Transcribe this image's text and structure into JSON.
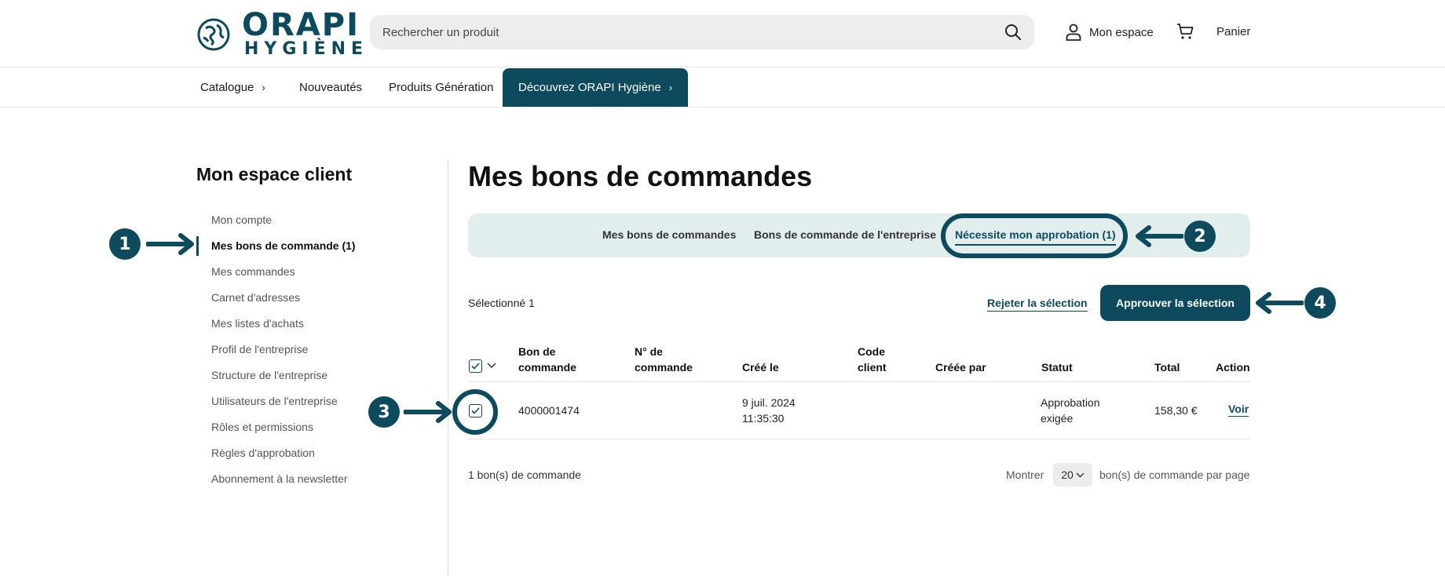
{
  "header": {
    "logo_line1": "ORAPI",
    "logo_line2": "HYGIÈNE",
    "search_placeholder": "Rechercher un produit",
    "account_label": "Mon espace",
    "cart_label": "Panier"
  },
  "nav": {
    "items": [
      {
        "label": "Catalogue"
      },
      {
        "label": "Nouveautés"
      },
      {
        "label": "Produits Génération"
      },
      {
        "label": "Découvrez ORAPI Hygiène"
      }
    ]
  },
  "sidebar": {
    "title": "Mon espace client",
    "items": [
      {
        "label": "Mon compte"
      },
      {
        "label": "Mes bons de commande (1)"
      },
      {
        "label": "Mes commandes"
      },
      {
        "label": "Carnet d'adresses"
      },
      {
        "label": "Mes listes d'achats"
      },
      {
        "label": "Profil de l'entreprise"
      },
      {
        "label": "Structure de l'entreprise"
      },
      {
        "label": "Utilisateurs de l'entreprise"
      },
      {
        "label": "Rôles et permissions"
      },
      {
        "label": "Règles d'approbation"
      },
      {
        "label": "Abonnement à la newsletter"
      }
    ]
  },
  "main": {
    "title": "Mes bons de commandes",
    "tabs": [
      {
        "label": "Mes bons de commandes"
      },
      {
        "label": "Bons de commande de l'entreprise"
      },
      {
        "label": "Nécessite mon approbation (1)"
      }
    ],
    "selected_text": "Sélectionné 1",
    "reject_label": "Rejeter la sélection",
    "approve_label": "Approuver la sélection"
  },
  "table": {
    "headers": {
      "po_line1": "Bon de",
      "po_line2": "commande",
      "num_line1": "N° de",
      "num_line2": "commande",
      "created": "Créé le",
      "code_line1": "Code",
      "code_line2": "client",
      "created_by": "Créée par",
      "status": "Statut",
      "total": "Total",
      "action": "Action"
    },
    "rows": [
      {
        "po": "4000001474",
        "date_line1": "9 juil. 2024",
        "date_line2": "11:35:30",
        "status_line1": "Approbation",
        "status_line2": "exigée",
        "total": "158,30 €",
        "action": "Voir"
      }
    ]
  },
  "footer": {
    "count_text": "1 bon(s) de commande",
    "show_label": "Montrer",
    "per_page_value": "20",
    "per_page_label": "bon(s) de commande par page"
  },
  "annotations": {
    "badges": [
      "1",
      "2",
      "3",
      "4"
    ]
  },
  "colors": {
    "brand": "#0d4a5e",
    "tab_bg": "#e2eeee",
    "search_bg": "#ededed"
  }
}
